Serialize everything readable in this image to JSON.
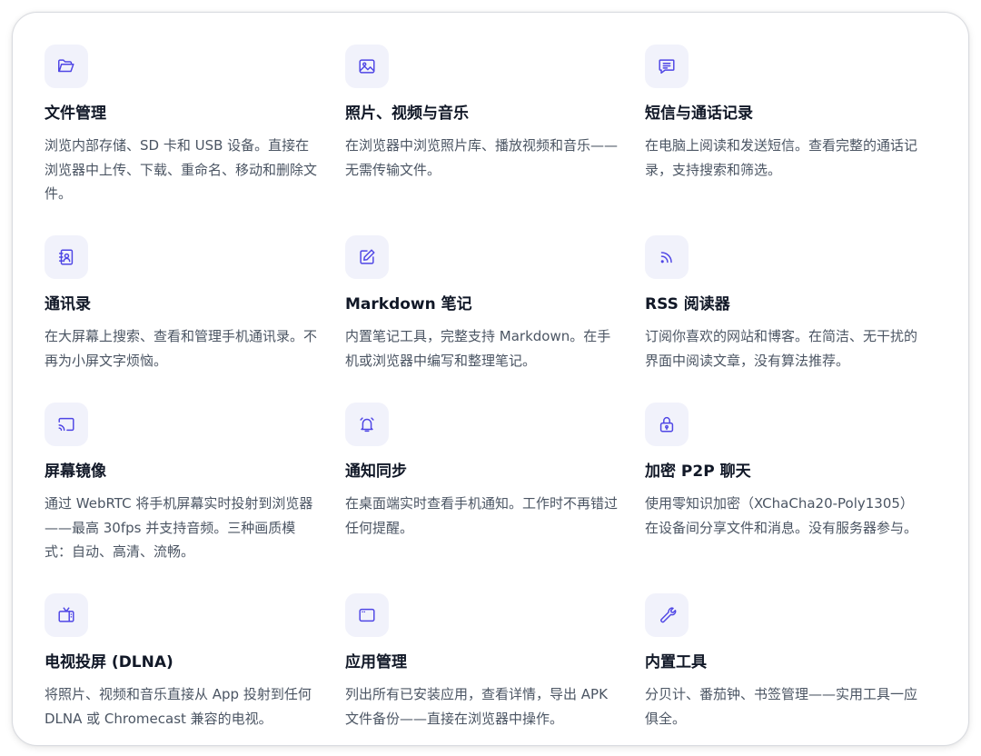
{
  "features": [
    {
      "icon": "folder-open-icon",
      "title": "文件管理",
      "desc": "浏览内部存储、SD 卡和 USB 设备。直接在浏览器中上传、下载、重命名、移动和删除文件。"
    },
    {
      "icon": "image-icon",
      "title": "照片、视频与音乐",
      "desc": "在浏览器中浏览照片库、播放视频和音乐——无需传输文件。"
    },
    {
      "icon": "message-icon",
      "title": "短信与通话记录",
      "desc": "在电脑上阅读和发送短信。查看完整的通话记录，支持搜索和筛选。"
    },
    {
      "icon": "contact-book-icon",
      "title": "通讯录",
      "desc": "在大屏幕上搜索、查看和管理手机通讯录。不再为小屏文字烦恼。"
    },
    {
      "icon": "edit-note-icon",
      "title": "Markdown 笔记",
      "desc": "内置笔记工具，完整支持 Markdown。在手机或浏览器中编写和整理笔记。"
    },
    {
      "icon": "rss-icon",
      "title": "RSS 阅读器",
      "desc": "订阅你喜欢的网站和博客。在简洁、无干扰的界面中阅读文章，没有算法推荐。"
    },
    {
      "icon": "cast-icon",
      "title": "屏幕镜像",
      "desc": "通过 WebRTC 将手机屏幕实时投射到浏览器——最高 30fps 并支持音频。三种画质模式：自动、高清、流畅。"
    },
    {
      "icon": "bell-icon",
      "title": "通知同步",
      "desc": "在桌面端实时查看手机通知。工作时不再错过任何提醒。"
    },
    {
      "icon": "lock-icon",
      "title": "加密 P2P 聊天",
      "desc": "使用零知识加密（XChaCha20-Poly1305）在设备间分享文件和消息。没有服务器参与。"
    },
    {
      "icon": "tv-icon",
      "title": "电视投屏 (DLNA)",
      "desc": "将照片、视频和音乐直接从 App 投射到任何 DLNA 或 Chromecast 兼容的电视。"
    },
    {
      "icon": "app-window-icon",
      "title": "应用管理",
      "desc": "列出所有已安装应用，查看详情，导出 APK 文件备份——直接在浏览器中操作。"
    },
    {
      "icon": "wrench-icon",
      "title": "内置工具",
      "desc": "分贝计、番茄钟、书签管理——实用工具一应俱全。"
    }
  ]
}
